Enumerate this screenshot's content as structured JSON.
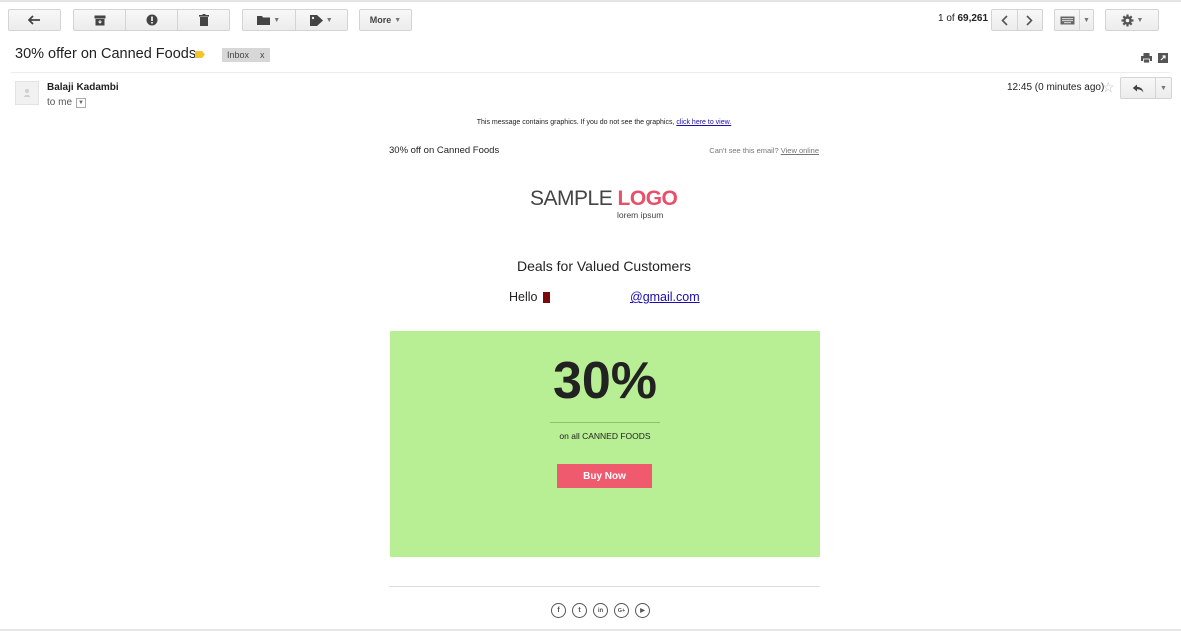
{
  "toolbar": {
    "more_label": "More",
    "counter_prefix": "1 of ",
    "counter_total": "69,261"
  },
  "message": {
    "subject": "30% offer on Canned Foods",
    "label_chip": "Inbox",
    "label_chip_close": "x",
    "sender_name": "Balaji Kadambi",
    "to_label": "to me",
    "timestamp": "12:45 (0 minutes ago)"
  },
  "email": {
    "graphics_notice": "This message contains graphics. If you do not see the graphics,",
    "graphics_link": "click here to view.",
    "header_subject": "30% off on Canned Foods",
    "cant_see": "Can't see this email?",
    "view_online": "View online",
    "logo_word1": "SAMPLE ",
    "logo_word2": "LOGO",
    "logo_tagline": "lorem ipsum",
    "heading": "Deals for Valued Customers",
    "greeting": "Hello",
    "email_suffix": "@gmail.com",
    "discount": "30%",
    "discount_sub": "on all CANNED FOODS",
    "cta": "Buy Now",
    "socials": [
      "f",
      "t",
      "in",
      "G+",
      "▶"
    ]
  },
  "colors": {
    "promo_bg": "#b9ef94",
    "cta_bg": "#ef5a6f",
    "logo_accent": "#e8506a",
    "label_yellow": "#f4c430"
  }
}
